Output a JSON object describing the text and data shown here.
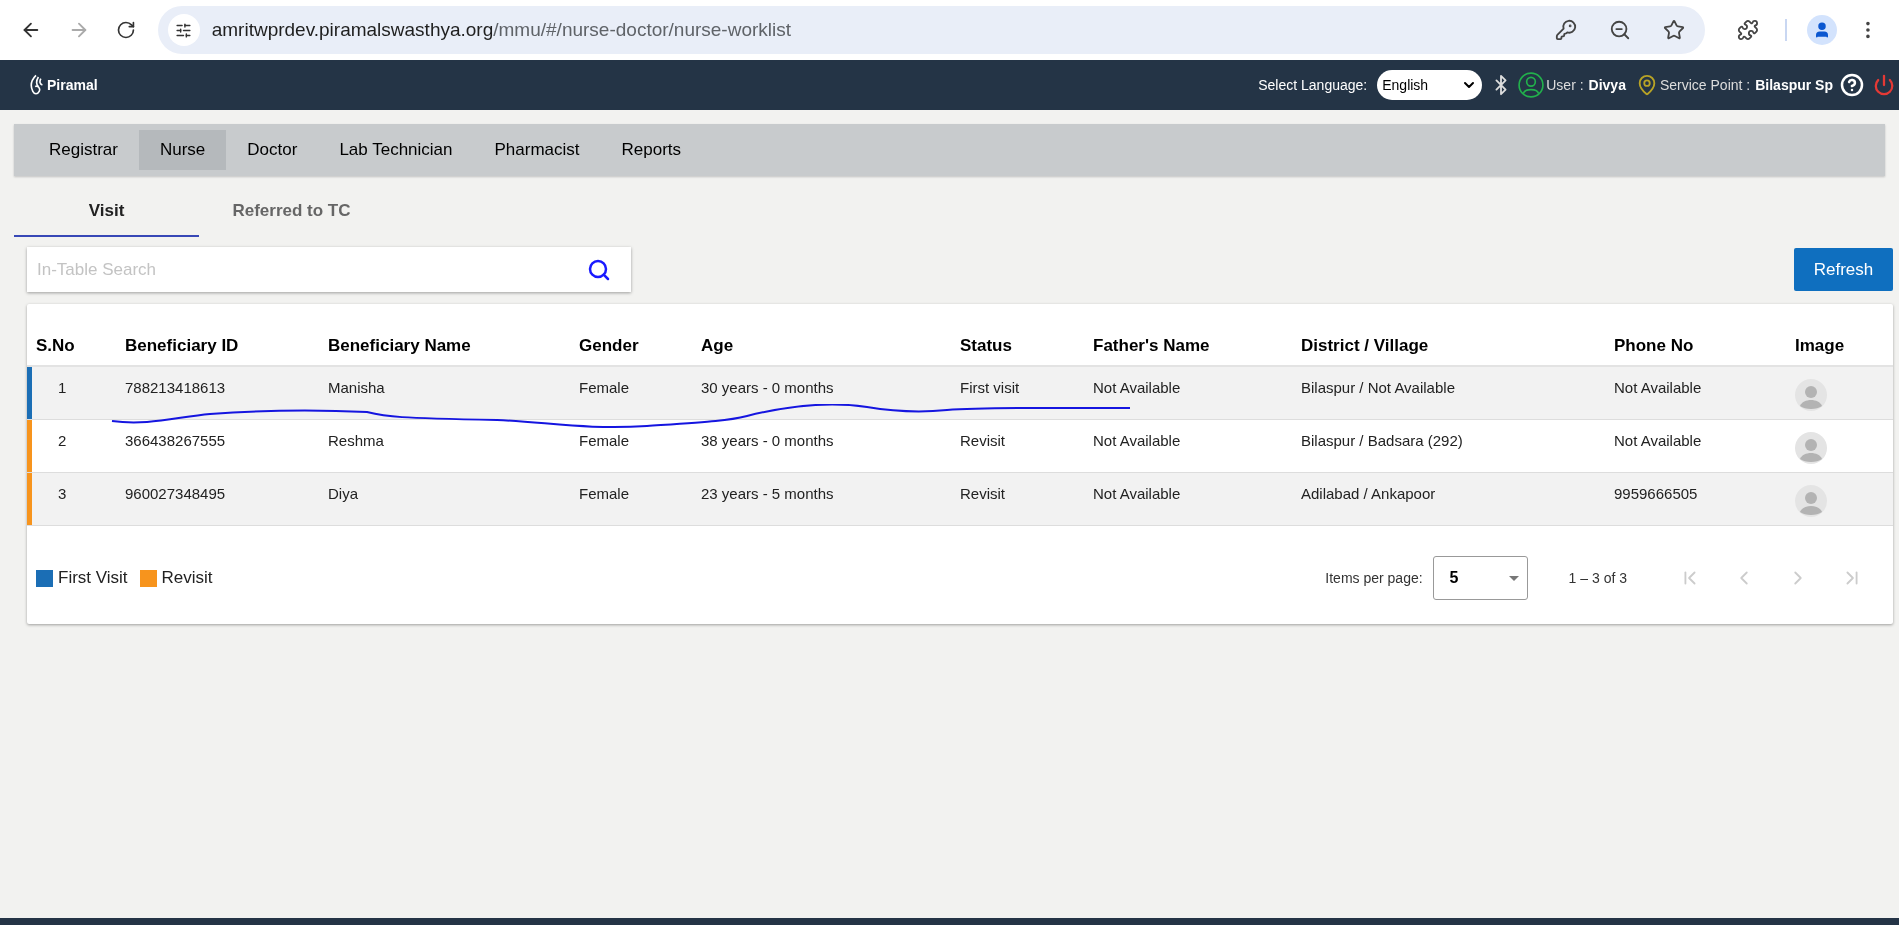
{
  "browser": {
    "url_host": "amritwprdev.piramalswasthya.org",
    "url_path": "/mmu/#/nurse-doctor/nurse-worklist"
  },
  "header": {
    "brand": "Piramal",
    "language_label": "Select Language:",
    "language_value": "English",
    "user_label": "User :",
    "user_name": "Divya",
    "service_point_label": "Service Point :",
    "service_point": "Bilaspur Sp"
  },
  "nav": [
    {
      "label": "Registrar",
      "selected": false
    },
    {
      "label": "Nurse",
      "selected": true
    },
    {
      "label": "Doctor",
      "selected": false
    },
    {
      "label": "Lab Technician",
      "selected": false
    },
    {
      "label": "Pharmacist",
      "selected": false
    },
    {
      "label": "Reports",
      "selected": false
    }
  ],
  "tabs": [
    {
      "label": "Visit",
      "selected": true
    },
    {
      "label": "Referred to TC",
      "selected": false
    }
  ],
  "search": {
    "placeholder": "In-Table Search"
  },
  "refresh_button": "Refresh",
  "table": {
    "columns": [
      "S.No",
      "Beneficiary ID",
      "Beneficiary Name",
      "Gender",
      "Age",
      "Status",
      "Father's Name",
      "District / Village",
      "Phone No",
      "Image"
    ],
    "rows": [
      {
        "color": "#1b6eb5",
        "cells": [
          "1",
          "788213418613",
          "Manisha",
          "Female",
          "30 years - 0 months",
          "First visit",
          "Not Available",
          "Bilaspur / Not Available",
          "Not Available"
        ]
      },
      {
        "color": "#f7941d",
        "cells": [
          "2",
          "366438267555",
          "Reshma",
          "Female",
          "38 years - 0 months",
          "Revisit",
          "Not Available",
          "Bilaspur / Badsara (292)",
          "Not Available"
        ]
      },
      {
        "color": "#f7941d",
        "cells": [
          "3",
          "960027348495",
          "Diya",
          "Female",
          "23 years - 5 months",
          "Revisit",
          "Not Available",
          "Adilabad / Ankapoor",
          "9959666505"
        ]
      }
    ]
  },
  "legend": [
    {
      "label": "First Visit",
      "color": "#1b6eb5"
    },
    {
      "label": "Revisit",
      "color": "#f7941d"
    }
  ],
  "paginator": {
    "items_per_page_label": "Items per page:",
    "items_per_page": "5",
    "range": "1 – 3 of 3"
  }
}
